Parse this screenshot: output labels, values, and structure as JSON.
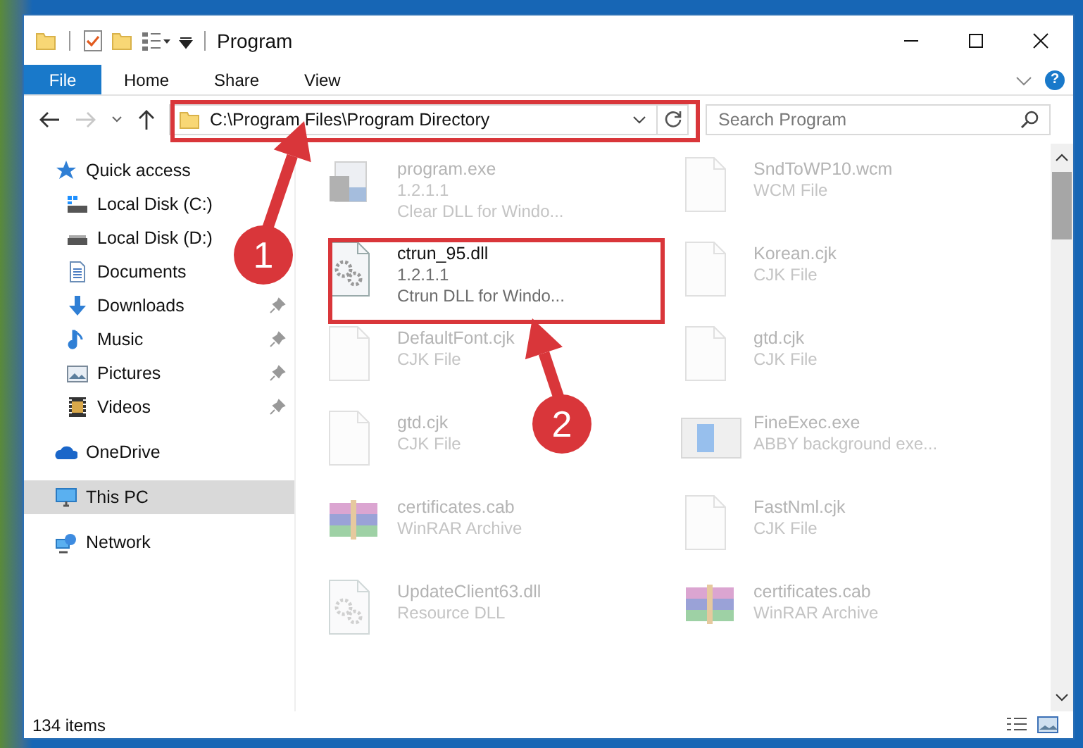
{
  "window": {
    "title": "Program"
  },
  "ribbon_tabs": [
    {
      "label": "File",
      "kind": "file"
    },
    {
      "label": "Home",
      "kind": "tab"
    },
    {
      "label": "Share",
      "kind": "tab"
    },
    {
      "label": "View",
      "kind": "tab"
    }
  ],
  "help_button": {
    "label": "?"
  },
  "navigation": {
    "back_disabled": false,
    "forward_disabled": true
  },
  "address_bar": {
    "path": "C:\\Program Files\\Program Directory"
  },
  "search": {
    "placeholder": "Search Program"
  },
  "sidebar": {
    "items": [
      {
        "label": "Quick access",
        "selected": false,
        "children": [
          {
            "label": "Local Disk (C:)",
            "pinned": false,
            "selected": false
          },
          {
            "label": "Local Disk (D:)",
            "pinned": false,
            "selected": false
          },
          {
            "label": "Documents",
            "pinned": false,
            "selected": false
          },
          {
            "label": "Downloads",
            "pinned": true,
            "selected": false
          },
          {
            "label": "Music",
            "pinned": true,
            "selected": false
          },
          {
            "label": "Pictures",
            "pinned": true,
            "selected": false
          },
          {
            "label": "Videos",
            "pinned": true,
            "selected": false
          }
        ]
      },
      {
        "label": "OneDrive",
        "selected": false
      },
      {
        "label": "This PC",
        "selected": true
      },
      {
        "label": "Network",
        "selected": false
      }
    ]
  },
  "files": [
    {
      "name": "program.exe",
      "details": [
        "1.2.1.1",
        "Clear DLL for Windo..."
      ],
      "kind": "exe",
      "faded": true
    },
    {
      "name": "SndToWP10.wcm",
      "details": [
        "WCM File"
      ],
      "kind": "blank",
      "faded": true
    },
    {
      "name": "ctrun_95.dll",
      "details": [
        "1.2.1.1",
        "Ctrun DLL for Windo..."
      ],
      "kind": "dll",
      "faded": false
    },
    {
      "name": "Korean.cjk",
      "details": [
        "CJK File"
      ],
      "kind": "blank",
      "faded": true
    },
    {
      "name": "DefaultFont.cjk",
      "details": [
        "CJK File"
      ],
      "kind": "blank",
      "faded": true
    },
    {
      "name": "gtd.cjk",
      "details": [
        "CJK File"
      ],
      "kind": "blank",
      "faded": true
    },
    {
      "name": "gtd.cjk",
      "details": [
        "CJK File"
      ],
      "kind": "blank",
      "faded": true
    },
    {
      "name": "FineExec.exe",
      "details": [
        "ABBY background exe..."
      ],
      "kind": "app",
      "faded": true
    },
    {
      "name": "certificates.cab",
      "details": [
        "WinRAR Archive"
      ],
      "kind": "archive",
      "faded": true
    },
    {
      "name": "FastNml.cjk",
      "details": [
        "CJK File"
      ],
      "kind": "blank",
      "faded": true
    },
    {
      "name": "UpdateClient63.dll",
      "details": [
        "Resource DLL"
      ],
      "kind": "dll",
      "faded": true
    },
    {
      "name": "certificates.cab",
      "details": [
        "WinRAR Archive"
      ],
      "kind": "archive",
      "faded": true
    }
  ],
  "status_bar": {
    "item_count": "134 items"
  },
  "callouts": [
    {
      "number": "1"
    },
    {
      "number": "2"
    }
  ]
}
